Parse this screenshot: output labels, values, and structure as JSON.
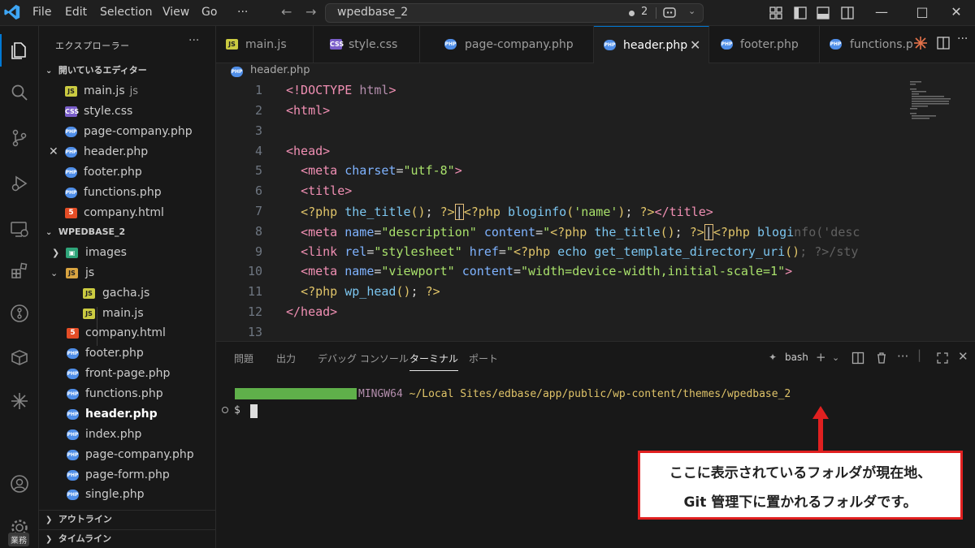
{
  "titlebar": {
    "menus": [
      "File",
      "Edit",
      "Selection",
      "View",
      "Go"
    ],
    "more": "···",
    "search_text": "wpedbase_2",
    "problems_count": "2"
  },
  "sidebar": {
    "title": "エクスプローラー",
    "open_editors": {
      "header": "開いているエディター",
      "items": [
        {
          "name": "main.js",
          "suffix": "js",
          "type": "js"
        },
        {
          "name": "style.css",
          "suffix": "",
          "type": "css"
        },
        {
          "name": "page-company.php",
          "suffix": "",
          "type": "php"
        },
        {
          "name": "header.php",
          "suffix": "",
          "type": "php"
        },
        {
          "name": "footer.php",
          "suffix": "",
          "type": "php"
        },
        {
          "name": "functions.php",
          "suffix": "",
          "type": "php"
        },
        {
          "name": "company.html",
          "suffix": "",
          "type": "html"
        }
      ]
    },
    "project": {
      "header": "WPEDBASE_2",
      "items": [
        {
          "name": "images",
          "type": "folder-img"
        },
        {
          "name": "js",
          "type": "folder"
        },
        {
          "name": "gacha.js",
          "type": "js"
        },
        {
          "name": "main.js",
          "type": "js"
        },
        {
          "name": "company.html",
          "type": "html"
        },
        {
          "name": "footer.php",
          "type": "php"
        },
        {
          "name": "front-page.php",
          "type": "php"
        },
        {
          "name": "functions.php",
          "type": "php"
        },
        {
          "name": "header.php",
          "type": "php"
        },
        {
          "name": "index.php",
          "type": "php"
        },
        {
          "name": "page-company.php",
          "type": "php"
        },
        {
          "name": "page-form.php",
          "type": "php"
        },
        {
          "name": "single.php",
          "type": "php"
        }
      ]
    },
    "outline": "アウトライン",
    "timeline": "タイムライン",
    "badge": "業務"
  },
  "tabs": [
    {
      "label": "main.js",
      "type": "js"
    },
    {
      "label": "style.css",
      "type": "css"
    },
    {
      "label": "page-company.php",
      "type": "php"
    },
    {
      "label": "header.php",
      "type": "php",
      "active": true
    },
    {
      "label": "footer.php",
      "type": "php"
    },
    {
      "label": "functions.p",
      "type": "php"
    }
  ],
  "breadcrumb": "header.php",
  "editor": {
    "line_numbers": [
      "1",
      "2",
      "3",
      "4",
      "5",
      "6",
      "7",
      "8",
      "9",
      "10",
      "11",
      "12",
      "13"
    ]
  },
  "panel": {
    "tabs": [
      "問題",
      "出力",
      "デバッグ コンソール",
      "ターミナル",
      "ポート"
    ],
    "active_tab": "ターミナル",
    "shell": "bash",
    "terminal_env": "MINGW64",
    "terminal_path": "~/Local Sites/edbase/app/public/wp-content/themes/wpedbase_2",
    "prompt": "$"
  },
  "callout": {
    "line1": "ここに表示されているフォルダが現在地、",
    "line2": "Git 管理下に置かれるフォルダです。"
  },
  "colors": {
    "accent": "#0078d4",
    "callout_border": "#e02020",
    "terminal_path": "#e0c469",
    "terminal_env": "#b48ead"
  }
}
